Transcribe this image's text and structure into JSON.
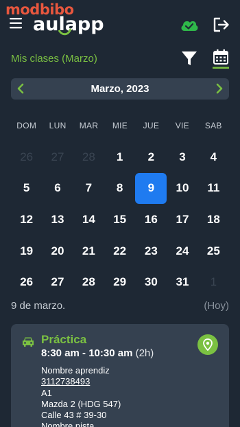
{
  "watermark": "modbibo",
  "header": {
    "logo_text": "aulapp",
    "menu_icon": "hamburger-menu-icon",
    "sync_icon": "cloud-check-icon",
    "logout_icon": "logout-icon"
  },
  "subheader": {
    "title": "Mis clases (Marzo)",
    "filter_icon": "filter-icon",
    "calendar_icon": "calendar-icon"
  },
  "calendar": {
    "month_label": "Marzo, 2023",
    "weekdays": [
      "DOM",
      "LUN",
      "MAR",
      "MIE",
      "JUE",
      "VIE",
      "SAB"
    ],
    "days": [
      {
        "n": "26",
        "faded": true
      },
      {
        "n": "27",
        "faded": true
      },
      {
        "n": "28",
        "faded": true
      },
      {
        "n": "1"
      },
      {
        "n": "2"
      },
      {
        "n": "3"
      },
      {
        "n": "4"
      },
      {
        "n": "5"
      },
      {
        "n": "6"
      },
      {
        "n": "7"
      },
      {
        "n": "8"
      },
      {
        "n": "9",
        "selected": true
      },
      {
        "n": "10"
      },
      {
        "n": "11"
      },
      {
        "n": "12"
      },
      {
        "n": "13"
      },
      {
        "n": "14"
      },
      {
        "n": "15"
      },
      {
        "n": "16"
      },
      {
        "n": "17"
      },
      {
        "n": "18"
      },
      {
        "n": "19"
      },
      {
        "n": "20"
      },
      {
        "n": "21"
      },
      {
        "n": "22"
      },
      {
        "n": "23"
      },
      {
        "n": "24"
      },
      {
        "n": "25"
      },
      {
        "n": "26"
      },
      {
        "n": "27"
      },
      {
        "n": "28"
      },
      {
        "n": "29"
      },
      {
        "n": "30"
      },
      {
        "n": "31"
      },
      {
        "n": "1",
        "faded": true
      }
    ]
  },
  "selected_date": {
    "label": "9 de marzo.",
    "today_tag": "(Hoy)"
  },
  "class_card": {
    "type": "Práctica",
    "time": "8:30 am - 10:30 am",
    "duration": "(2h)",
    "lines": [
      "Nombre aprendiz",
      "3112738493",
      "A1",
      "Mazda 2 (HDG 547)",
      "Calle 43 # 39-30",
      "Nombre pista"
    ]
  },
  "colors": {
    "background": "#1e2834",
    "accent_green": "#7bc142",
    "selected_blue": "#1f7bf0",
    "surface": "#354150",
    "watermark": "#e8573e"
  }
}
